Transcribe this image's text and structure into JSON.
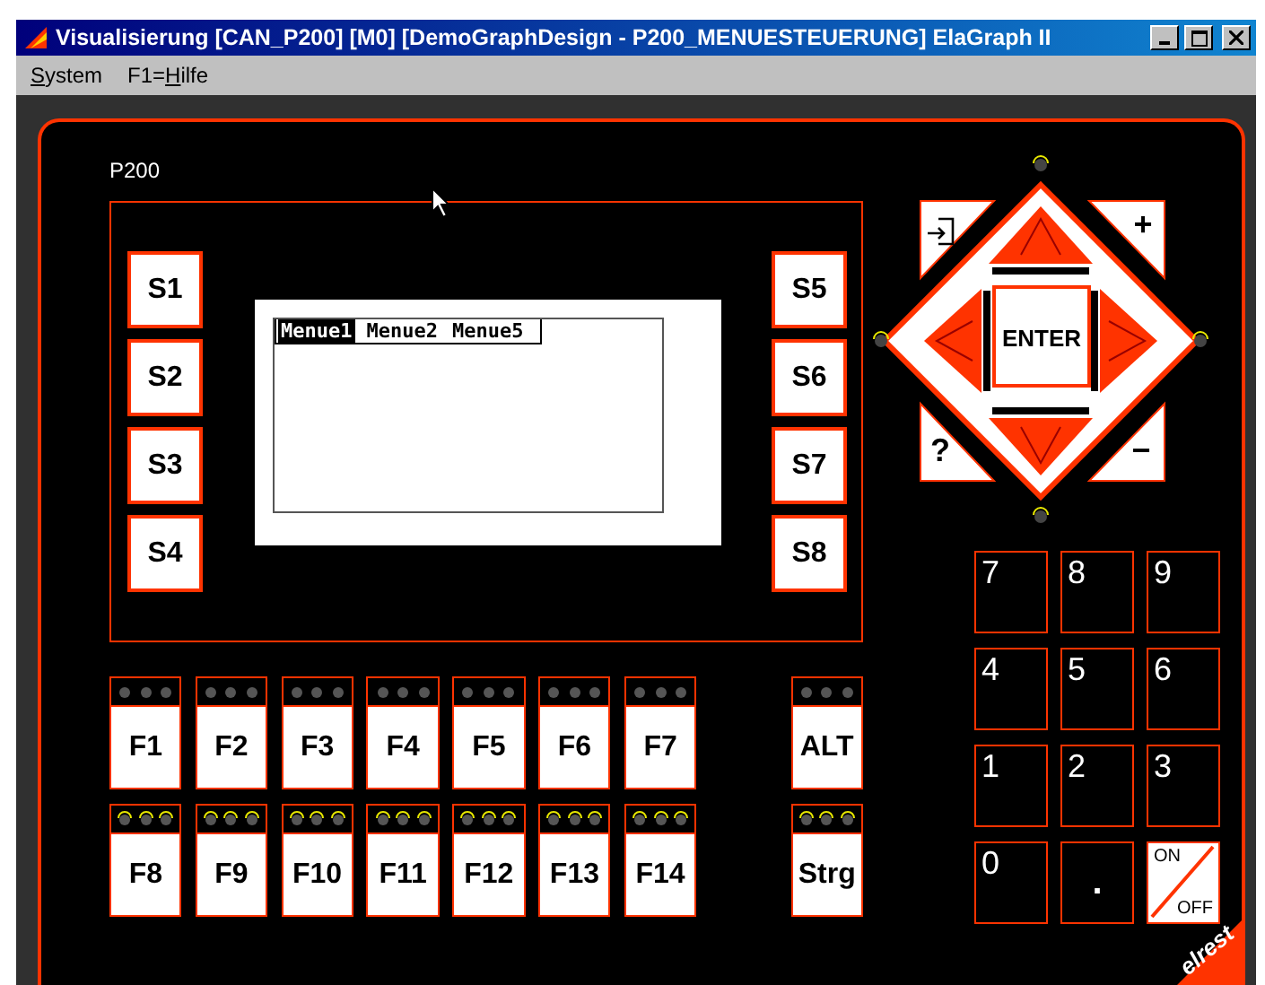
{
  "window": {
    "title": "Visualisierung [CAN_P200] [M0] [DemoGraphDesign - P200_MENUESTEUERUNG] ElaGraph II"
  },
  "menu": [
    {
      "key": "S",
      "post": "ystem"
    },
    {
      "pre": "F1=",
      "key": "H",
      "post": "ilfe"
    }
  ],
  "device": {
    "model": "P200",
    "soft_keys_left": [
      "S1",
      "S2",
      "S3",
      "S4"
    ],
    "soft_keys_right": [
      "S5",
      "S6",
      "S7",
      "S8"
    ],
    "display_menu": [
      {
        "label": "Menue1",
        "selected": true
      },
      {
        "label": "Menue2",
        "selected": false
      },
      {
        "label": "Menue5",
        "selected": false
      }
    ],
    "key_rows": [
      {
        "keys": [
          {
            "label": "F1",
            "led_lit": false
          },
          {
            "label": "F2",
            "led_lit": false
          },
          {
            "label": "F3",
            "led_lit": false
          },
          {
            "label": "F4",
            "led_lit": false
          },
          {
            "label": "F5",
            "led_lit": false
          },
          {
            "label": "F6",
            "led_lit": false
          },
          {
            "label": "F7",
            "led_lit": false
          }
        ],
        "modifier": {
          "label": "ALT",
          "led_lit": false
        }
      },
      {
        "keys": [
          {
            "label": "F8",
            "led_lit": true
          },
          {
            "label": "F9",
            "led_lit": true
          },
          {
            "label": "F10",
            "led_lit": true
          },
          {
            "label": "F11",
            "led_lit": true
          },
          {
            "label": "F12",
            "led_lit": true
          },
          {
            "label": "F13",
            "led_lit": true
          },
          {
            "label": "F14",
            "led_lit": true
          }
        ],
        "modifier": {
          "label": "Strg",
          "led_lit": true
        }
      }
    ],
    "nav": {
      "center": "ENTER",
      "corners": [
        {
          "kind": "icon"
        },
        {
          "kind": "text",
          "label": "+"
        },
        {
          "kind": "text",
          "label": "?"
        },
        {
          "kind": "text",
          "label": "−"
        }
      ]
    },
    "keypad": [
      {
        "kind": "digit",
        "label": "7"
      },
      {
        "kind": "digit",
        "label": "8"
      },
      {
        "kind": "digit",
        "label": "9"
      },
      {
        "kind": "digit",
        "label": "4"
      },
      {
        "kind": "digit",
        "label": "5"
      },
      {
        "kind": "digit",
        "label": "6"
      },
      {
        "kind": "digit",
        "label": "1"
      },
      {
        "kind": "digit",
        "label": "2"
      },
      {
        "kind": "digit",
        "label": "3"
      },
      {
        "kind": "digit",
        "label": "0"
      },
      {
        "kind": "dot",
        "label": "."
      },
      {
        "kind": "onoff",
        "on": "ON",
        "off": "OFF"
      }
    ],
    "brand": "elrest"
  }
}
